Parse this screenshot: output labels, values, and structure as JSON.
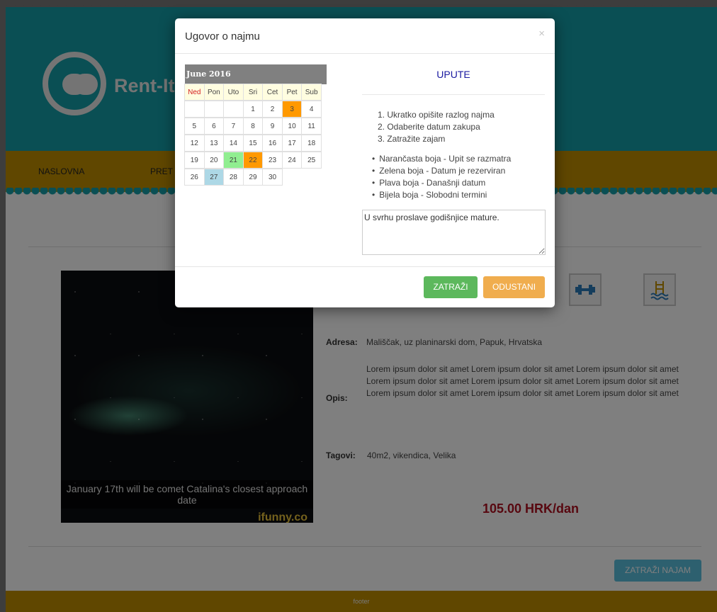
{
  "site": {
    "brand": "Rent-It-",
    "footer": "footer"
  },
  "nav": {
    "items": [
      "NASLOVNA",
      "PRET"
    ]
  },
  "listing": {
    "photo_caption": "January 17th will be comet Catalina's closest approach date",
    "photo_watermark": "ifunny.co",
    "address_label": "Adresa:",
    "address": "Mališčak, uz planinarski dom, Papuk, Hrvatska",
    "desc_label": "Opis:",
    "description": "Lorem ipsum dolor sit amet Lorem ipsum dolor sit amet Lorem ipsum dolor sit amet Lorem ipsum dolor sit amet Lorem ipsum dolor sit amet Lorem ipsum dolor sit amet Lorem ipsum dolor sit amet Lorem ipsum dolor sit amet Lorem ipsum dolor sit amet",
    "tags_label": "Tagovi:",
    "tags": "40m2, vikendica, Velika",
    "price": "105.00 HRK/dan",
    "rent_button": "ZATRAŽI NAJAM",
    "amenity_icons": [
      "dumbbell-icon",
      "pool-icon"
    ]
  },
  "modal": {
    "title": "Ugovor o najmu",
    "close": "×",
    "calendar": {
      "title": "June 2016",
      "weekdays": [
        "Ned",
        "Pon",
        "Uto",
        "Sri",
        "Cet",
        "Pet",
        "Sub"
      ],
      "weeks": [
        [
          "",
          "",
          "",
          "1",
          "2",
          "3",
          "4"
        ],
        [
          "5",
          "6",
          "7",
          "8",
          "9",
          "10",
          "11"
        ],
        [
          "12",
          "13",
          "14",
          "15",
          "16",
          "17",
          "18"
        ],
        [
          "19",
          "20",
          "21",
          "22",
          "23",
          "24",
          "25"
        ],
        [
          "26",
          "27",
          "28",
          "29",
          "30",
          "",
          ""
        ]
      ],
      "highlights": {
        "3": "#ff9900",
        "22": "#ff9900",
        "21": "#90ee90",
        "27": "#add8e6"
      }
    },
    "instructions": {
      "title": "UPUTE",
      "steps": [
        "1. Ukratko opišite razlog najma",
        "2. Odaberite datum zakupa",
        "3. Zatražite zajam"
      ],
      "legend": [
        "Narančasta boja - Upit se razmatra",
        "Zelena boja - Datum je rezerviran",
        "Plava boja - Današnji datum",
        "Bijela boja - Slobodni termini"
      ]
    },
    "reason_text": "U svrhu proslave godišnjice mature.",
    "submit": "ZATRAŽI",
    "cancel": "ODUSTANI"
  },
  "colors": {
    "teal": "#159fa8",
    "gold": "#c08e00",
    "price": "#b01020",
    "pending": "#ff9900",
    "reserved": "#90ee90",
    "today": "#add8e6"
  }
}
